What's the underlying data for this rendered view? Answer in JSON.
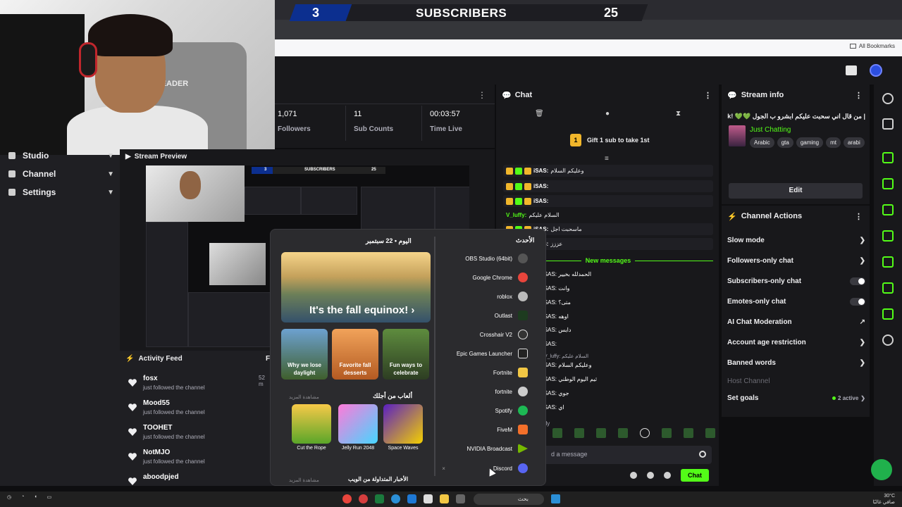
{
  "banner": {
    "left_count": "3",
    "title": "SUBSCRIBERS",
    "right_count": "25"
  },
  "browser": {
    "bookmarks_label": "All Bookmarks"
  },
  "webcam": {
    "chair_text": "LEADER"
  },
  "leftnav": {
    "items": [
      {
        "label": "Studio"
      },
      {
        "label": "Channel"
      },
      {
        "label": "Settings"
      }
    ]
  },
  "stats": [
    {
      "value": "1,071",
      "label": "Followers"
    },
    {
      "value": "11",
      "label": "Sub Counts"
    },
    {
      "value": "00:03:57",
      "label": "Time Live"
    }
  ],
  "preview": {
    "title": "Stream Preview",
    "mini_banner": {
      "left": "3",
      "title": "SUBSCRIBERS",
      "right": "25"
    }
  },
  "feed": {
    "title": "Activity Feed",
    "right_label": "Fi",
    "items": [
      {
        "name": "fosx",
        "sub": "just followed the channel",
        "ago": "52 m"
      },
      {
        "name": "Mood55",
        "sub": "just followed the channel",
        "ago": ""
      },
      {
        "name": "TOOHET",
        "sub": "just followed the channel",
        "ago": ""
      },
      {
        "name": "NotMJO",
        "sub": "just followed the channel",
        "ago": ""
      },
      {
        "name": "aboodpjed",
        "sub": "",
        "ago": ""
      }
    ]
  },
  "chat": {
    "title": "Chat",
    "gift_text": "Gift 1 sub to take 1st",
    "gift_rank": "1",
    "messages": [
      {
        "user": "iSAS:",
        "text": "وعليكم السلام"
      },
      {
        "user": "iSAS:",
        "text": ""
      },
      {
        "user": "iSAS:",
        "text": ""
      },
      {
        "user": "V_luffy:",
        "text": "السلام عليكم"
      },
      {
        "user": "iSAS:",
        "text": "ماسحبت اجل"
      },
      {
        "user": "iSAS:",
        "text": "عززز"
      }
    ],
    "new_messages": "New messages",
    "new_msgs": [
      {
        "user": "iSAS:",
        "text": "الحمدلله بخيير"
      },
      {
        "user": "iSAS:",
        "text": "وانت"
      },
      {
        "user": "iSAS:",
        "text": "متى؟"
      },
      {
        "user": "iSAS:",
        "text": "اوهه"
      },
      {
        "user": "iSAS:",
        "text": "دايس"
      },
      {
        "user": "iSAS:",
        "text": ""
      },
      {
        "user": "iSAS:",
        "text": "وعليكم السلام"
      },
      {
        "user": "iSAS:",
        "text": "ثيم اليوم الوطني"
      },
      {
        "user": "iSAS:",
        "text": "جوي"
      },
      {
        "user": "iSAS:",
        "text": "اي"
      }
    ],
    "reply_preview": "V_luffy: السلام عليكم",
    "only_label": "nly",
    "input_placeholder": "d a message",
    "send_label": "Chat"
  },
  "stream_info": {
    "title": "Stream info",
    "stream_title": "| من قال اني سحبت عليكم ابشرو ب الجول 💚💚 !2k?",
    "category": "Just Chatting",
    "tags": [
      "Arabic",
      "gta",
      "gaming",
      "mt",
      "arabi"
    ],
    "edit_label": "Edit"
  },
  "channel_actions": {
    "title": "Channel Actions",
    "items": [
      {
        "label": "Slow mode",
        "type": "chevron"
      },
      {
        "label": "Followers-only chat",
        "type": "chevron"
      },
      {
        "label": "Subscribers-only chat",
        "type": "toggle"
      },
      {
        "label": "Emotes-only chat",
        "type": "toggle"
      },
      {
        "label": "AI Chat Moderation",
        "type": "external"
      },
      {
        "label": "Account age restriction",
        "type": "chevron"
      },
      {
        "label": "Banned words",
        "type": "chevron"
      },
      {
        "label": "Host Channel",
        "type": "disabled"
      },
      {
        "label": "Set goals",
        "type": "goals"
      }
    ],
    "goals_status": "2 active"
  },
  "startmenu": {
    "date_label": "اليوم • 22 سبتمبر",
    "hero_title": "It's the fall equinox! ›",
    "cards": [
      {
        "label": "Why we lose daylight"
      },
      {
        "label": "Favorite fall desserts"
      },
      {
        "label": "Fun ways to celebrate"
      }
    ],
    "games_header": "ألعاب من أجلك",
    "games_hint": "مشاهدة المزيد",
    "games": [
      {
        "label": "Cut the Rope"
      },
      {
        "label": "Jelly Run 2048"
      },
      {
        "label": "Space Waves"
      }
    ],
    "news_header": "الأخبار المتداولة من الويب",
    "news_hint": "مشاهدة المزيد",
    "apps_header": "الأحدث",
    "apps": [
      {
        "label": "OBS Studio (64bit)",
        "color": "#555"
      },
      {
        "label": "Google Chrome",
        "color": "#e8453c"
      },
      {
        "label": "roblox",
        "color": "#bbbbbb"
      },
      {
        "label": "Outlast",
        "color": "#1d3b1f"
      },
      {
        "label": "Crosshair V2",
        "color": "#333"
      },
      {
        "label": "Epic Games Launcher",
        "color": "#222"
      },
      {
        "label": "Fortnite",
        "color": "#f2c744"
      },
      {
        "label": "fortnite",
        "color": "#cccccc"
      },
      {
        "label": "Spotify",
        "color": "#1db954"
      },
      {
        "label": "FiveM",
        "color": "#f4702a"
      },
      {
        "label": "NVIDIA Broadcast",
        "color": "#76b900"
      },
      {
        "label": "Discord",
        "color": "#5865f2"
      }
    ]
  },
  "taskbar": {
    "search": "بحث",
    "temp": "30°C",
    "status": "صافي غالبًا"
  }
}
